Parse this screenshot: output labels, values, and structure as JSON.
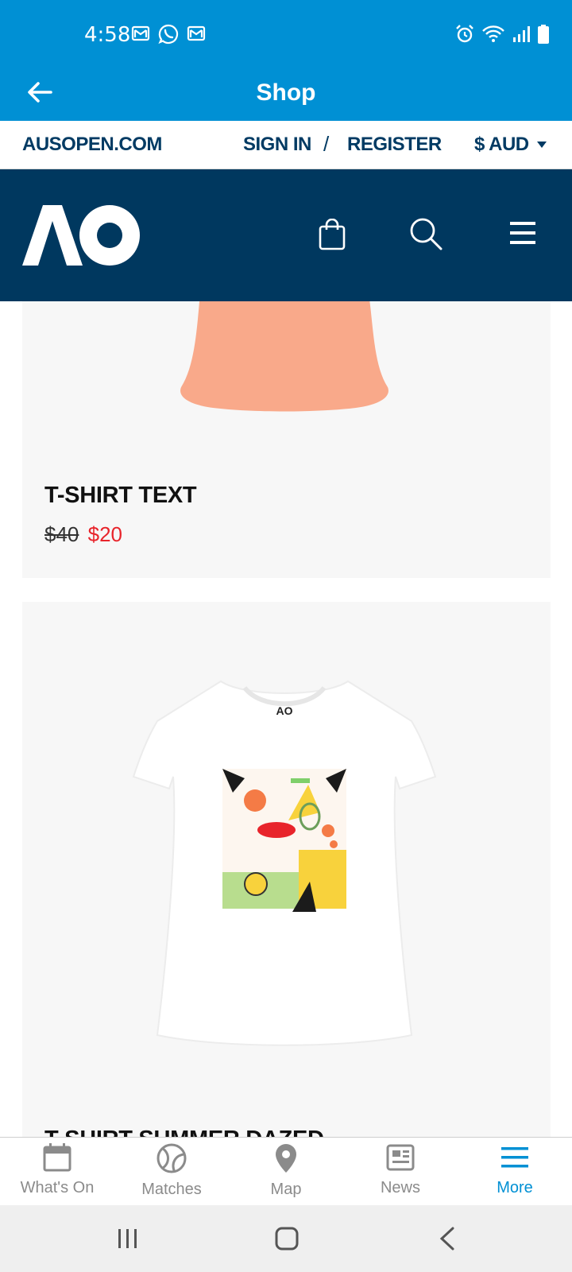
{
  "status_bar": {
    "time": "4:58",
    "left_icons": [
      "gmail-icon",
      "whatsapp-icon",
      "gmail-icon"
    ],
    "right_icons": [
      "alarm-icon",
      "wifi-icon",
      "signal-icon",
      "battery-icon"
    ]
  },
  "app_bar": {
    "title": "Shop",
    "back_icon": "arrow-left-icon"
  },
  "site_topbar": {
    "site_link": "AUSOPEN.COM",
    "sign_in": "SIGN IN",
    "separator": "/",
    "register": "REGISTER",
    "currency": "$ AUD"
  },
  "site_header": {
    "logo_text": "AO",
    "icons": [
      "shopping-bag-icon",
      "search-icon",
      "hamburger-menu-icon"
    ]
  },
  "products": [
    {
      "name": "T-SHIRT TEXT",
      "old_price": "$40",
      "sale_price": "$20",
      "color": "#f9a98a"
    },
    {
      "name": "T-SHIRT SUMMER DAZED",
      "color": "#ffffff"
    }
  ],
  "bottom_nav": {
    "items": [
      {
        "label": "What's On",
        "icon": "calendar-icon"
      },
      {
        "label": "Matches",
        "icon": "tennis-ball-icon"
      },
      {
        "label": "Map",
        "icon": "map-pin-icon"
      },
      {
        "label": "News",
        "icon": "news-icon"
      },
      {
        "label": "More",
        "icon": "hamburger-menu-icon",
        "active": true
      }
    ]
  },
  "colors": {
    "brand_blue": "#0090d4",
    "navy": "#00385f",
    "sale_red": "#e8242b"
  }
}
